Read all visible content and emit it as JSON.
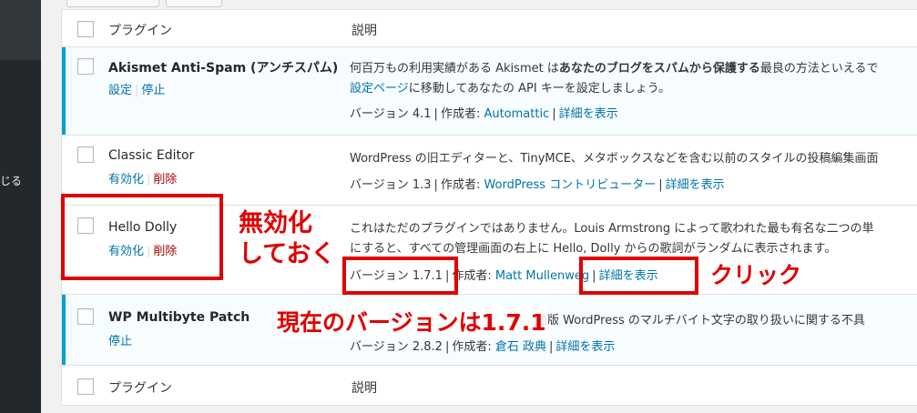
{
  "sidebar": {
    "fragment": "じる"
  },
  "table": {
    "head": {
      "plugin": "プラグイン",
      "description": "説明"
    },
    "foot": {
      "plugin": "プラグイン",
      "description": "説明"
    }
  },
  "plugins": [
    {
      "name_latin": "Akismet Anti-Spam (",
      "name_bold": "アンチスパム",
      "name_end": ")",
      "action_1": "設定",
      "action_2": "停止",
      "desc_a": "何百万もの利用実績がある Akismet は",
      "desc_b": "あなたのブログをスパムから保護する",
      "desc_c": "最良の方法といえるで",
      "desc2_link": "設定ページ",
      "desc2_rest": "に移動してあなたの API キーを設定しましょう。",
      "version": "バージョン 4.1",
      "by_label": "作成者: ",
      "author": "Automattic",
      "details": "詳細を表示"
    },
    {
      "name": "Classic Editor",
      "action_1": "有効化",
      "action_2": "削除",
      "desc": "WordPress の旧エディターと、TinyMCE、メタボックスなどを含む以前のスタイルの投稿編集画面",
      "version": "バージョン 1.3",
      "by_label": "作成者: ",
      "author": "WordPress コントリビューター",
      "details": "詳細を表示"
    },
    {
      "name": "Hello Dolly",
      "action_1": "有効化",
      "action_2": "削除",
      "desc_line1": "これはただのプラグインではありません。Louis Armstrong によって歌われた最も有名な二つの単",
      "desc_line2": "にすると、すべての管理画面の右上に Hello, Dolly からの歌詞がランダムに表示されます。",
      "version": "バージョン 1.7.1",
      "by_label": "作成者: ",
      "author": "Matt Mullenweg",
      "details": "詳細を表示"
    },
    {
      "name": "WP Multibyte Patch",
      "action_1": "停止",
      "desc_hidden": "マルチバイト語版、日本語版 WordPress のマルチバイト文字の取り扱いに関する不具",
      "desc": "語版 WordPress のマルチバイト文字の取り扱いに関する不具",
      "version": "バージョン 2.8.2",
      "by_label": "作成者: ",
      "author": "倉石 政典",
      "details": "詳細を表示"
    }
  ],
  "annotations": {
    "deactivate_line1": "無効化",
    "deactivate_line2": "しておく",
    "current_version": "現在のバージョンは1.7.1",
    "click": "クリック"
  },
  "colors": {
    "annotation_red": "#e00000",
    "link": "#0073aa",
    "delete": "#a00",
    "active_border": "#00a0d2"
  }
}
